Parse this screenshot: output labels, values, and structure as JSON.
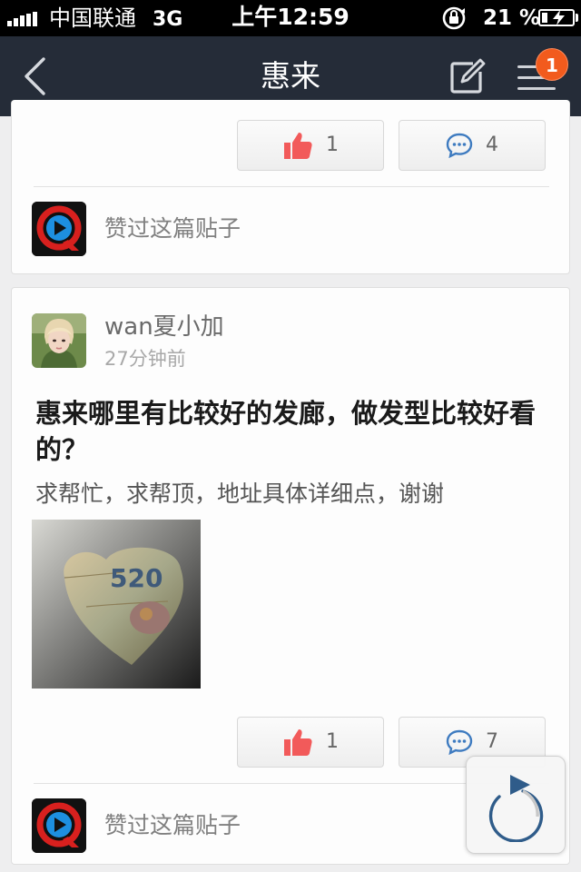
{
  "status_bar": {
    "carrier": "中国联通",
    "network": "3G",
    "time": "上午12:59",
    "battery_percent": "21 %",
    "icons": [
      "signal-icon",
      "rotation-lock-icon",
      "battery-charging-icon"
    ]
  },
  "nav": {
    "title": "惠来",
    "badge_count": "1",
    "icons": [
      "back-chevron-icon",
      "compose-icon",
      "menu-icon"
    ]
  },
  "posts": [
    {
      "likes": "1",
      "comments": "4",
      "likers_label": "赞过这篇贴子"
    },
    {
      "author": "wan夏小加",
      "time": "27分钟前",
      "title": "惠来哪里有比较好的发廊，做发型比较好看的？",
      "body": "求帮忙，求帮顶，地址具体详细点，谢谢",
      "image_text": "520",
      "likes": "1",
      "comments": "7",
      "likers_label": "赞过这篇贴子"
    }
  ],
  "colors": {
    "nav_bg": "#252c38",
    "badge": "#f25b1d",
    "like_icon": "#f25a5a",
    "comment_icon": "#3e7bc0",
    "page_bg": "#eeeeef"
  }
}
